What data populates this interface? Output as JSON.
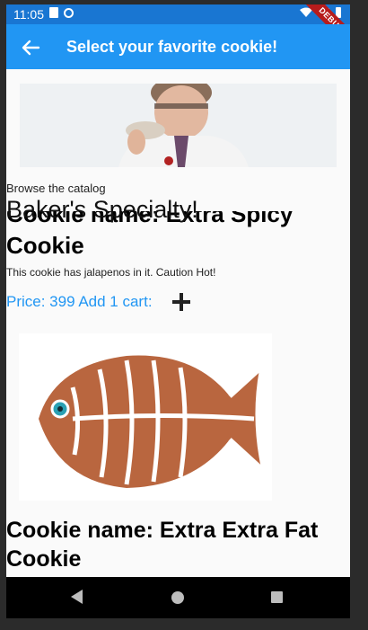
{
  "status_bar": {
    "time": "11:05",
    "debug_label": "DEBUG"
  },
  "app_bar": {
    "title": "Select your favorite cookie!"
  },
  "header": {
    "browse_label": "Browse the catalog",
    "section_title": "Baker's Specialty!"
  },
  "cookies": [
    {
      "name_line1": "Cookie name: Extra Spicy",
      "name_line2": "Cookie",
      "description": "This cookie has jalapenos in it. Caution Hot!",
      "price_text": "Price: 399 Add 1 cart:",
      "image_icon": "man-eating-cookie-photo"
    },
    {
      "name": "Cookie name: Extra Extra Fat Cookie",
      "image_icon": "fish-cookie-photo"
    }
  ],
  "nav": {
    "back_icon": "back-triangle-icon",
    "home_icon": "home-circle-icon",
    "recent_icon": "recents-square-icon"
  }
}
